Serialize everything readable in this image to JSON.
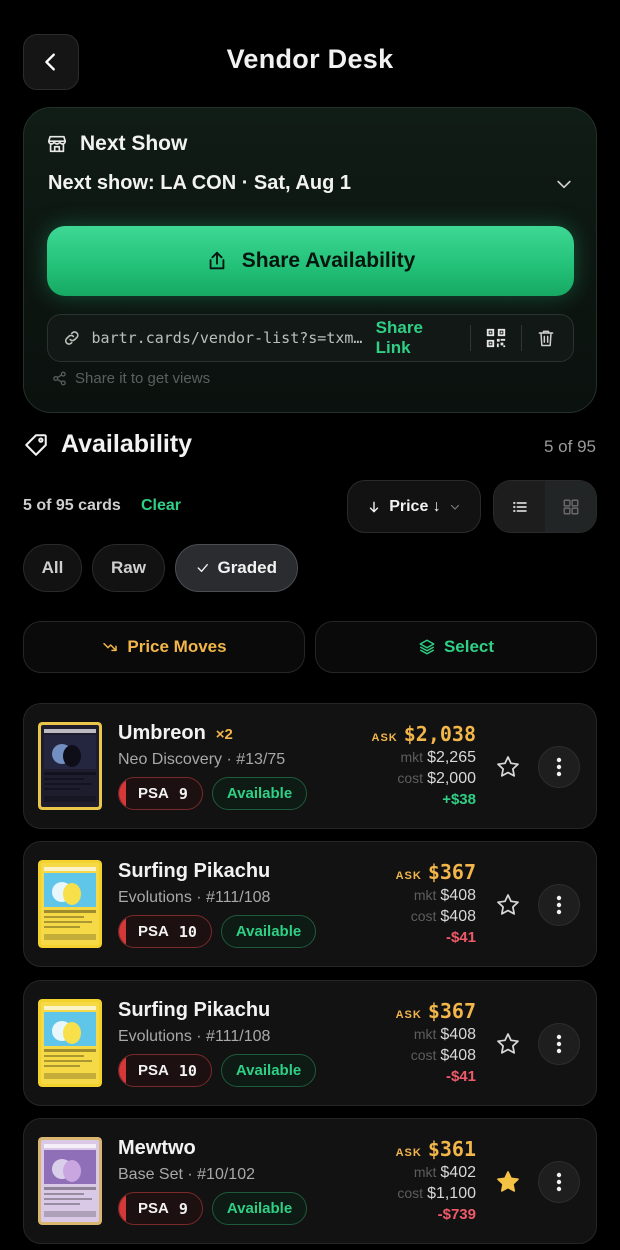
{
  "header": {
    "title": "Vendor Desk",
    "back_icon": "chevron-left-icon"
  },
  "next_show": {
    "heading": "Next Show",
    "selected": "Next show: LA CON · Sat, Aug 1",
    "share_button": "Share Availability",
    "link_url": "bartr.cards/vendor-list?s=txm…",
    "share_link": "Share Link",
    "hint": "Share it to get views"
  },
  "availability": {
    "heading": "Availability",
    "count": "5 of 95",
    "cards_count": "5 of 95 cards",
    "clear": "Clear",
    "sort_label": "Price ↓"
  },
  "chips": [
    "All",
    "Raw",
    "Graded"
  ],
  "active_chip": "Graded",
  "actions": {
    "price_moves": "Price Moves",
    "select": "Select"
  },
  "colors": {
    "accent_green": "#2fcf85",
    "ask_gold": "#f2b64a",
    "negative": "#ef5a6a",
    "psa_red": "#d43838"
  },
  "cards": [
    {
      "name": "Umbreon",
      "qty": "×2",
      "set": "Neo Discovery · #13/75",
      "psa": "PSA",
      "grade": "9",
      "status": "Available",
      "ask_label": "ASK",
      "ask": "$2,038",
      "mkt_label": "mkt",
      "mkt": "$2,265",
      "cost_label": "cost",
      "cost": "$2,000",
      "diff": "+$38",
      "diff_sign": "pos",
      "starred": false
    },
    {
      "name": "Surfing Pikachu",
      "qty": "",
      "set": "Evolutions · #111/108",
      "psa": "PSA",
      "grade": "10",
      "status": "Available",
      "ask_label": "ASK",
      "ask": "$367",
      "mkt_label": "mkt",
      "mkt": "$408",
      "cost_label": "cost",
      "cost": "$408",
      "diff": "-$41",
      "diff_sign": "neg",
      "starred": false
    },
    {
      "name": "Surfing Pikachu",
      "qty": "",
      "set": "Evolutions · #111/108",
      "psa": "PSA",
      "grade": "10",
      "status": "Available",
      "ask_label": "ASK",
      "ask": "$367",
      "mkt_label": "mkt",
      "mkt": "$408",
      "cost_label": "cost",
      "cost": "$408",
      "diff": "-$41",
      "diff_sign": "neg",
      "starred": false
    },
    {
      "name": "Mewtwo",
      "qty": "",
      "set": "Base Set · #10/102",
      "psa": "PSA",
      "grade": "9",
      "status": "Available",
      "ask_label": "ASK",
      "ask": "$361",
      "mkt_label": "mkt",
      "mkt": "$402",
      "cost_label": "cost",
      "cost": "$1,100",
      "diff": "-$739",
      "diff_sign": "neg",
      "starred": true
    }
  ]
}
